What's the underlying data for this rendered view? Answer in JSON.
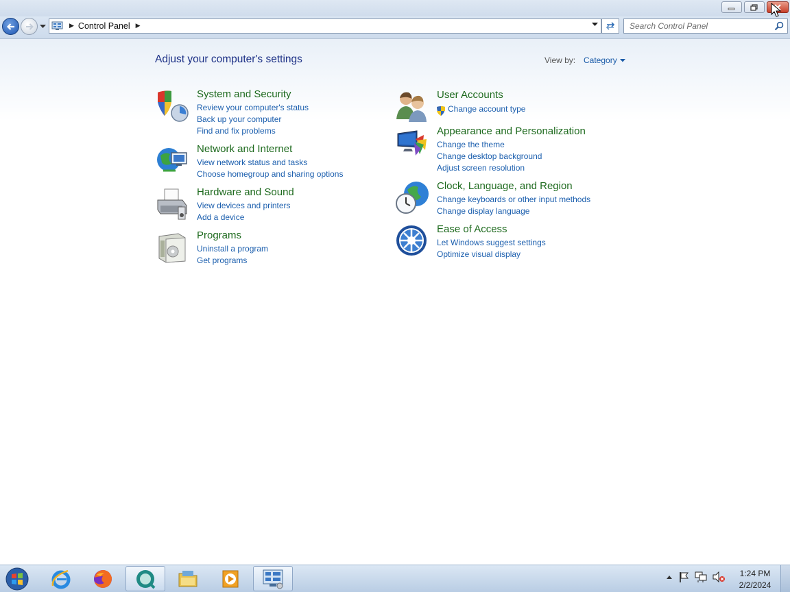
{
  "window": {
    "minimize_icon": "minimize-icon",
    "restore_icon": "restore-icon",
    "close_icon": "close-icon"
  },
  "navbar": {
    "breadcrumb": "Control Panel",
    "search_placeholder": "Search Control Panel"
  },
  "main": {
    "title": "Adjust your computer's settings",
    "view_by_label": "View by:",
    "view_by_value": "Category"
  },
  "categories": [
    {
      "title": "System and Security",
      "icon": "shield-icon",
      "links": [
        "Review your computer's status",
        "Back up your computer",
        "Find and fix problems"
      ]
    },
    {
      "title": "Network and Internet",
      "icon": "network-globe-icon",
      "links": [
        "View network status and tasks",
        "Choose homegroup and sharing options"
      ]
    },
    {
      "title": "Hardware and Sound",
      "icon": "printer-icon",
      "links": [
        "View devices and printers",
        "Add a device"
      ]
    },
    {
      "title": "Programs",
      "icon": "programs-icon",
      "links": [
        "Uninstall a program",
        "Get programs"
      ]
    },
    {
      "title": "User Accounts",
      "icon": "users-icon",
      "links": [
        "Change account type"
      ]
    },
    {
      "title": "Appearance and Personalization",
      "icon": "monitor-palette-icon",
      "links": [
        "Change the theme",
        "Change desktop background",
        "Adjust screen resolution"
      ]
    },
    {
      "title": "Clock, Language, and Region",
      "icon": "clock-globe-icon",
      "links": [
        "Change keyboards or other input methods",
        "Change display language"
      ]
    },
    {
      "title": "Ease of Access",
      "icon": "ease-of-access-icon",
      "links": [
        "Let Windows suggest settings",
        "Optimize visual display"
      ]
    }
  ],
  "taskbar": {
    "items": [
      "start-orb-icon",
      "internet-explorer-icon",
      "firefox-icon",
      "app-icon",
      "file-explorer-icon",
      "media-player-icon",
      "control-panel-icon"
    ],
    "clock_time": "1:24 PM",
    "clock_date": "2/2/2024"
  }
}
